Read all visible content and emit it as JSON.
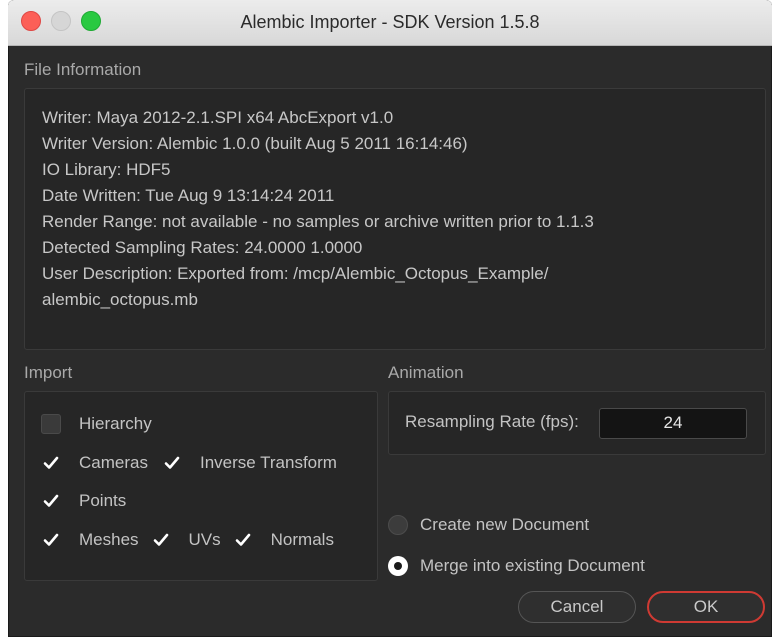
{
  "window": {
    "title": "Alembic Importer - SDK Version 1.5.8"
  },
  "file_information": {
    "label": "File Information",
    "lines": [
      "Writer: Maya 2012-2.1.SPI x64 AbcExport v1.0",
      "Writer Version: Alembic 1.0.0 (built Aug  5 2011 16:14:46)",
      "IO Library: HDF5",
      "Date Written: Tue Aug  9 13:14:24 2011",
      "Render Range: not available - no samples or archive written prior to 1.1.3",
      "Detected Sampling Rates: 24.0000 1.0000",
      "User Description: Exported from: /mcp/Alembic_Octopus_Example/",
      "alembic_octopus.mb"
    ]
  },
  "import": {
    "label": "Import",
    "hierarchy": {
      "label": "Hierarchy",
      "checked": false
    },
    "cameras": {
      "label": "Cameras",
      "checked": true
    },
    "inverse_transform": {
      "label": "Inverse Transform",
      "checked": true
    },
    "points": {
      "label": "Points",
      "checked": true
    },
    "meshes": {
      "label": "Meshes",
      "checked": true
    },
    "uvs": {
      "label": "UVs",
      "checked": true
    },
    "normals": {
      "label": "Normals",
      "checked": true
    }
  },
  "animation": {
    "label": "Animation",
    "resampling_label": "Resampling Rate (fps):",
    "resampling_value": "24"
  },
  "document": {
    "create_new": {
      "label": "Create new Document",
      "selected": false
    },
    "merge_existing": {
      "label": "Merge into existing Document",
      "selected": true
    }
  },
  "buttons": {
    "cancel": "Cancel",
    "ok": "OK"
  },
  "colors": {
    "ok_border": "#cf3a33",
    "panel_bg": "#262626",
    "window_bg": "#2b2b2b"
  }
}
